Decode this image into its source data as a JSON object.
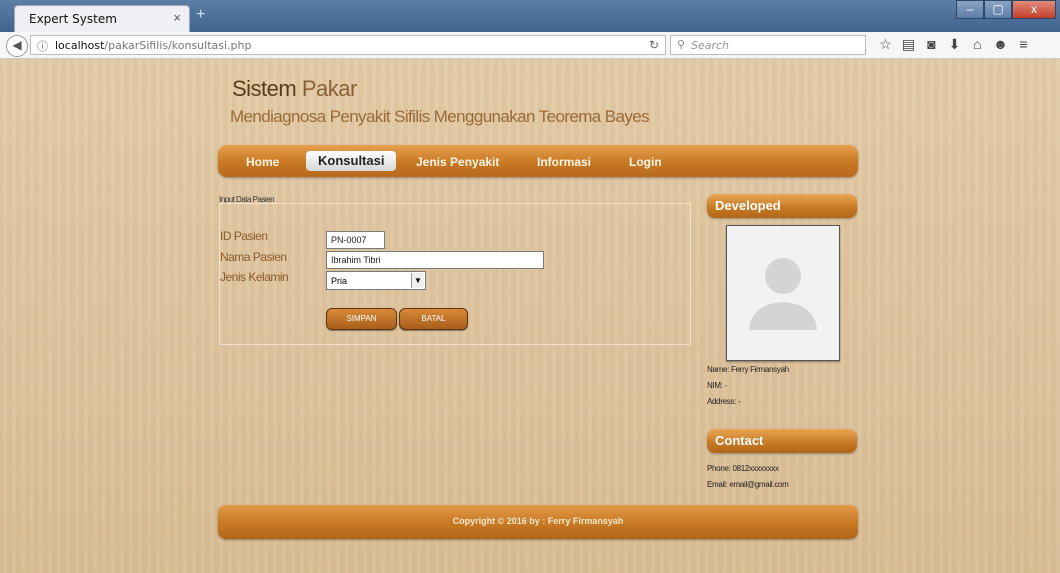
{
  "browser": {
    "tab_title": "Expert System",
    "tab_close": "×",
    "new_tab": "+",
    "url_host": "localhost",
    "url_path": "/pakarSifilis/konsultasi.php",
    "search_placeholder": "Search",
    "window_buttons": [
      "–",
      "▢",
      "x"
    ]
  },
  "site": {
    "title_part1": "Sistem",
    "title_part2": " Pakar",
    "subtitle": "Mendiagnosa Penyakit Sifilis Menggunakan Teorema Bayes"
  },
  "menu": {
    "items": [
      "Home",
      "Konsultasi",
      "Jenis Penyakit",
      "Informasi",
      "Login"
    ],
    "active": "Konsultasi"
  },
  "form": {
    "section_label": "Input Data Pasien",
    "id_label": "ID Pasien",
    "id_value": "PN-0007",
    "name_label": "Nama Pasien",
    "name_value": "Ibrahim Tibri",
    "gender_label": "Jenis Kelamin",
    "gender_value": "Pria",
    "save_label": "SIMPAN",
    "cancel_label": "BATAL"
  },
  "sidebar": {
    "developed_title": "Developed",
    "name_line": "Name: Ferry Firmansyah",
    "nim_line": "NIM: -",
    "address_line": "Address: -",
    "contact_title": "Contact",
    "phone_line": "Phone: 0812xxxxxxxx",
    "email_line": "Email: email@gmail.com"
  },
  "footer": {
    "copyright": "Copyright © 2016 by : Ferry Firmansyah"
  },
  "colors": {
    "accent_orange": "#c87822",
    "label_brown": "#8a5a28"
  }
}
